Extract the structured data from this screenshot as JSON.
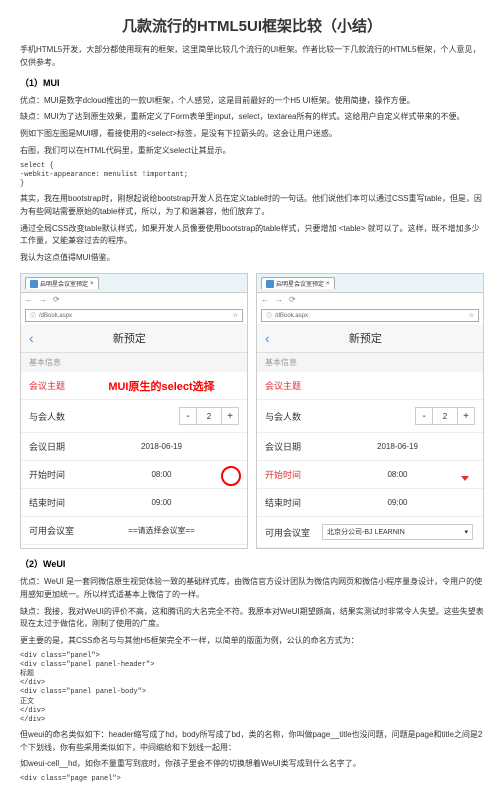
{
  "title": "几款流行的HTML5UI框架比较（小结）",
  "intro": "手机HTML5开发，大部分都使用现有的框架，这里简单比较几个流行的UI框架。作者比较一下几款流行的HTML5框架，个人意见，仅供参考。",
  "section1": {
    "heading": "（1）MUI",
    "p1": "优点：MUI是数字dcloud推出的一款UI框架，个人感觉，这是目前最好的一个H5 UI框架。使用简捷，操作方便。",
    "p2": "缺点：MUI为了达到原生效果，重新定义了Form表单里input，select，textarea所有的样式。这给用户自定义样式带来的不便。",
    "p3": "例如下图左图是MUI哪，看接使用的<select>标签，是没有下拉箭头的。这会让用户迷惑。",
    "p4": "右图，我们可以在HTML代码里，重新定义select让其显示。",
    "code1": "select {\n-webkit-appearance: menulist !important;\n}",
    "p5": "其实，我在用bootstrap时，刚想起说给bootstrap开发人员在定义table时的一句话。他们说他们本可以通过CSS重写table，但是，因为有些网站需要原始的table样式，所以，为了和谐兼容，他们放弃了。",
    "p6": "通过全局CSS改变table默认样式，如果开发人员像要使用bootstrap的table样式，只要增加 <table> 就可以了。这样，既不增加多少工作量，又能兼容过去的程序。",
    "p7": "我认为这点值得MUI借鉴。"
  },
  "phone": {
    "tab_label": "启明星会议室预定",
    "url": "/dBook.aspx",
    "back": "‹",
    "header": "新预定",
    "section": "基本信息",
    "row1": "会议主题",
    "row2": "与会人数",
    "row3": "会议日期",
    "row4": "开始时间",
    "row5": "结束时间",
    "row6": "可用会议室",
    "date": "2018-06-19",
    "time1": "08:00",
    "time2": "09:00",
    "select_placeholder": "==请选择会议室==",
    "select_value": "北京分公司-BJ LEARNIN",
    "stepper": "2",
    "overlay": "MUI原生的select选择"
  },
  "section2": {
    "heading": "（2）WeUI",
    "p1": "优点：WeUI 是一套同微信原生视觉体验一致的基础样式库，由微信官方设计团队为微信内网页和微信小程序量身设计，令用户的使用感知更加统一。所以样式适基本上微信了的一样。",
    "p2": "缺点：我接，我对WeUI的评价不高，这和腾讯的大名完全不符。我原本对WeUI期望颇高，结果实测试时非常令人失望。这些失望表现在太过于做信化，刚制了使用的广度。",
    "p3": "更主要的是，其CSS命名与与其他H5框架完全不一样，以简单的版面为例，公认的命名方式为：",
    "code2": "<div class=\"panel\">\n<div class=\"panel panel-header\">\n标题\n</div>\n<div class=\"panel panel-body\">\n正文\n</div>\n</div>",
    "p4": "但weui的命名类似如下：header缩写成了hd，body所写成了bd，类的名称，你叫做page__title也没问题，问题是page和title之间是2个下划线，你有些采用类似如下，中间缩给和下划线一起用：",
    "p5": "如weui-cell__hd，如你不量重写到底时，你孩子里会不停的切换想着WeUI类写成到什么名字了。",
    "code3": "<div class=\"page panel\">"
  }
}
